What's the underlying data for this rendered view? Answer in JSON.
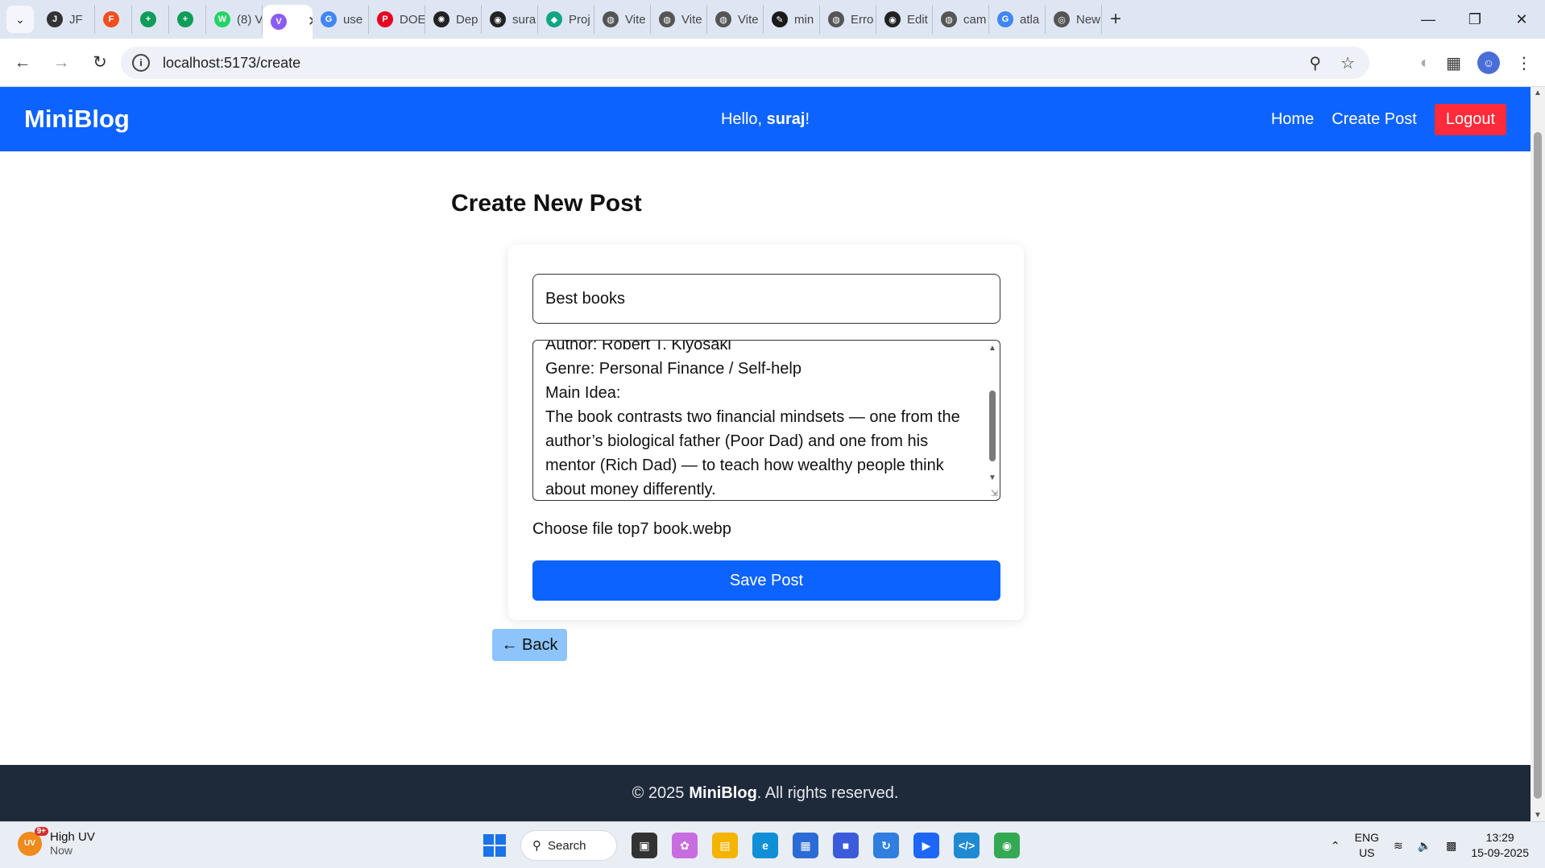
{
  "browser": {
    "tabs": [
      {
        "label": "JF",
        "icon": "jotform-icon",
        "color": "#333333"
      },
      {
        "label": "",
        "icon": "figma-icon",
        "color": "#f24e1e"
      },
      {
        "label": "",
        "icon": "sheets-icon",
        "color": "#0f9d58"
      },
      {
        "label": "",
        "icon": "sheets-icon",
        "color": "#0f9d58"
      },
      {
        "label": "(8) V",
        "icon": "whatsapp-icon",
        "color": "#25d366"
      },
      {
        "label": "",
        "icon": "vite-icon",
        "color": "#8a5cf6",
        "active": true
      },
      {
        "label": "use",
        "icon": "google-icon",
        "color": "#4285f4"
      },
      {
        "label": "DOE",
        "icon": "pinterest-icon",
        "color": "#e60023"
      },
      {
        "label": "Dep",
        "icon": "openai-icon",
        "color": "#222222"
      },
      {
        "label": "sura",
        "icon": "github-icon",
        "color": "#222222"
      },
      {
        "label": "Proj",
        "icon": "diamond-icon",
        "color": "#11a683"
      },
      {
        "label": "Vite",
        "icon": "globe-icon",
        "color": "#555555"
      },
      {
        "label": "Vite",
        "icon": "globe-icon",
        "color": "#555555"
      },
      {
        "label": "Vite",
        "icon": "globe-icon",
        "color": "#555555"
      },
      {
        "label": "min",
        "icon": "app-icon",
        "color": "#1a1a1a"
      },
      {
        "label": "Erro",
        "icon": "globe-icon",
        "color": "#555555"
      },
      {
        "label": "Edit",
        "icon": "github-icon",
        "color": "#222222"
      },
      {
        "label": "cam",
        "icon": "globe-icon",
        "color": "#555555"
      },
      {
        "label": "atla",
        "icon": "google-icon",
        "color": "#4285f4"
      },
      {
        "label": "New",
        "icon": "chrome-icon",
        "color": "#555555"
      }
    ],
    "url": "localhost:5173/create"
  },
  "app": {
    "brand": "MiniBlog",
    "greeting_prefix": "Hello, ",
    "username": "suraj",
    "greeting_suffix": "!",
    "nav": {
      "home": "Home",
      "create": "Create Post",
      "logout": "Logout"
    },
    "colors": {
      "primary": "#0d63ff",
      "danger": "#ff2b3a",
      "back": "#8cc4fb",
      "footer": "#1e2939"
    }
  },
  "form": {
    "page_title": "Create New Post",
    "title_value": "Best books",
    "body_value": "Author: Robert T. Kiyosaki\nGenre: Personal Finance / Self-help\nMain Idea:\nThe book contrasts two financial mindsets — one from the author’s biological father (Poor Dad) and one from his mentor (Rich Dad) — to teach how wealthy people think about money differently.",
    "file_label": "Choose file",
    "file_name": "top7 book.webp",
    "save_label": "Save Post",
    "back_label": "← Back"
  },
  "footer": {
    "prefix": "© 2025 ",
    "brand": "MiniBlog",
    "suffix": ". All rights reserved."
  },
  "taskbar": {
    "weather_title": "High UV",
    "weather_sub": "Now",
    "weather_badge": "9+",
    "search_label": "Search",
    "lang_1": "ENG",
    "lang_2": "US",
    "time": "13:29",
    "date": "15-09-2025"
  }
}
